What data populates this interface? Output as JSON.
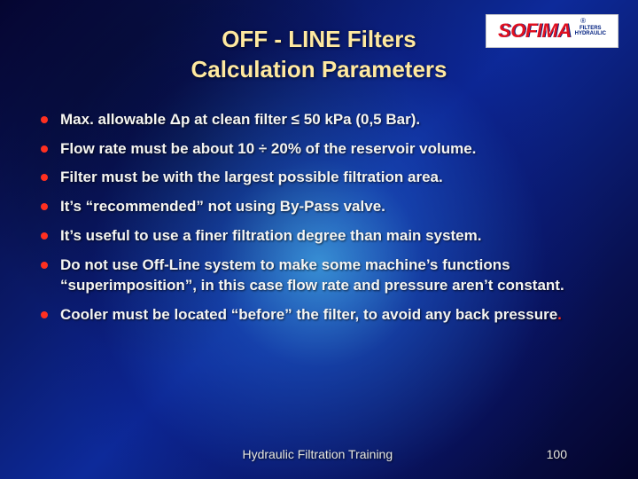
{
  "title_line1": "OFF - LINE Filters",
  "title_line2": "Calculation Parameters",
  "logo": {
    "brand": "SOFIMA",
    "tag_top": "FILTERS",
    "tag_bottom": "HYDRAULIC",
    "reg": "®"
  },
  "bullets": [
    "Max. allowable Δp at clean filter ≤ 50 kPa (0,5 Bar).",
    "Flow rate must be about 10 ÷ 20% of the reservoir volume.",
    "Filter must be with the largest possible filtration area.",
    "It’s “recommended” not using By-Pass valve.",
    "It’s useful to use a finer filtration degree than main system.",
    "Do not use Off-Line system to make some machine’s functions “superimposition”, in this case flow rate and pressure aren’t constant.",
    "Cooler must be located “before” the filter, to avoid any back pressure"
  ],
  "last_trail": ".",
  "footer_center": "Hydraulic Filtration Training",
  "footer_page": "100"
}
